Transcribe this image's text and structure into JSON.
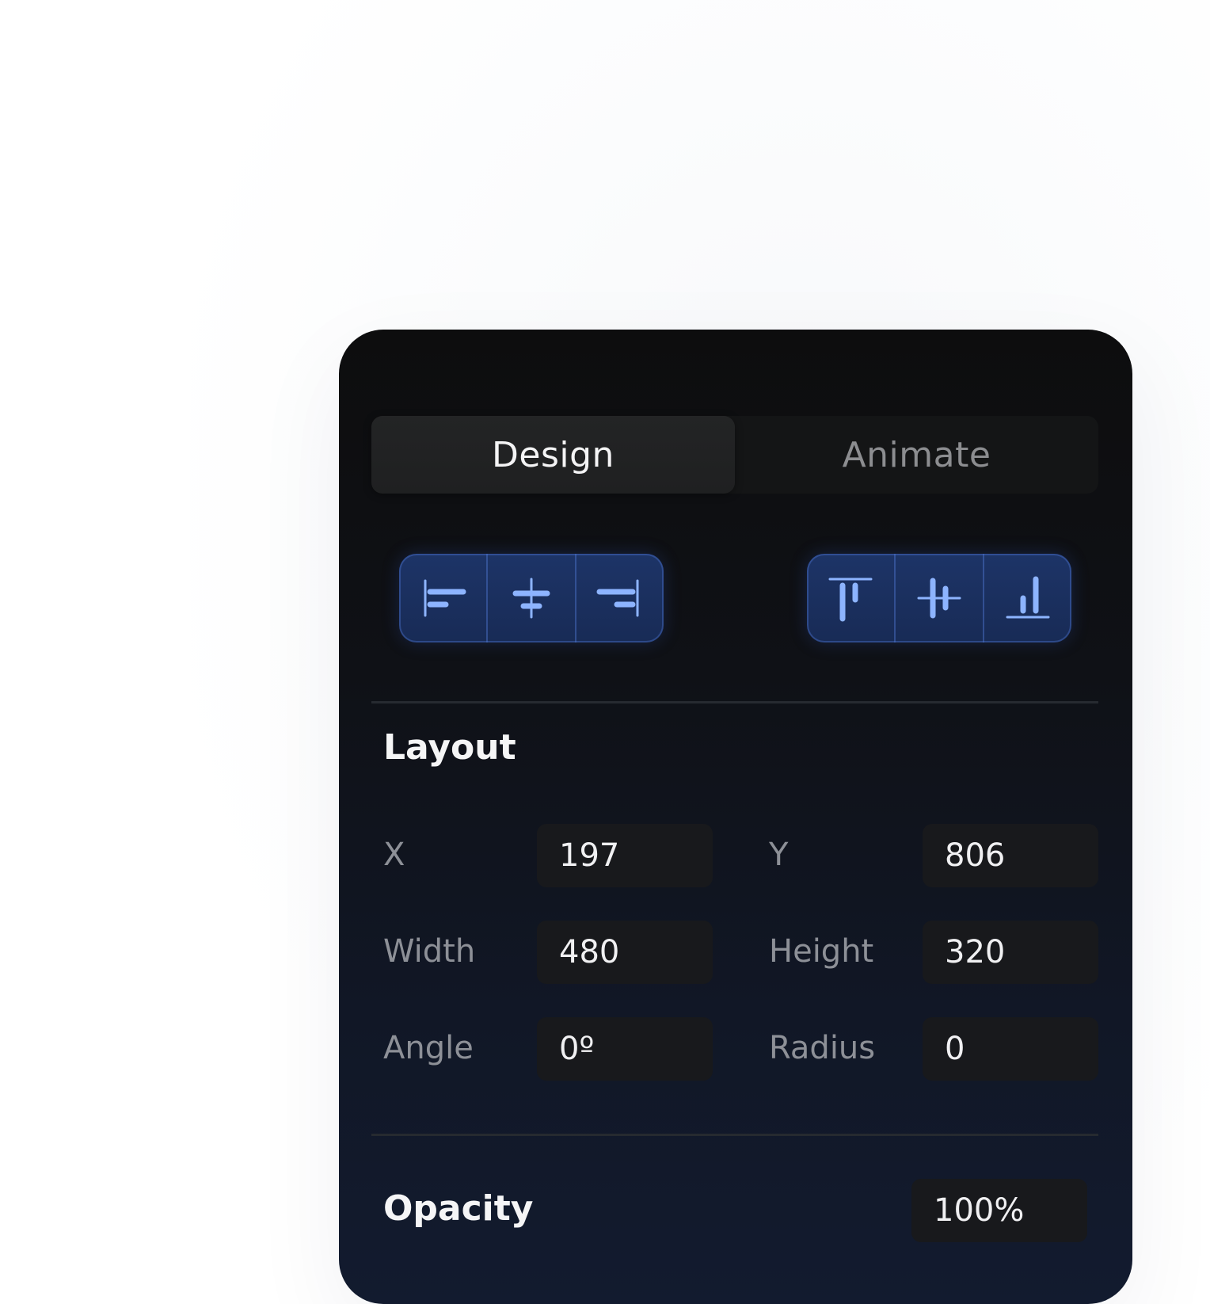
{
  "tabs": [
    {
      "label": "Design",
      "active": true
    },
    {
      "label": "Animate",
      "active": false
    }
  ],
  "alignment": {
    "horizontal": [
      {
        "icon": "align-left-icon"
      },
      {
        "icon": "align-horizontal-center-icon"
      },
      {
        "icon": "align-right-icon"
      }
    ],
    "vertical": [
      {
        "icon": "align-top-icon"
      },
      {
        "icon": "align-vertical-center-icon"
      },
      {
        "icon": "align-bottom-icon"
      }
    ]
  },
  "layout": {
    "title": "Layout",
    "fields": {
      "x": {
        "label": "X",
        "value": "197"
      },
      "y": {
        "label": "Y",
        "value": "806"
      },
      "width": {
        "label": "Width",
        "value": "480"
      },
      "height": {
        "label": "Height",
        "value": "320"
      },
      "angle": {
        "label": "Angle",
        "value": "0º"
      },
      "radius": {
        "label": "Radius",
        "value": "0"
      }
    }
  },
  "opacity": {
    "title": "Opacity",
    "value": "100%"
  },
  "colors": {
    "panel_bg": "#0f1116",
    "accent_blue": "#8db4ff",
    "button_bg": "#1d3467"
  }
}
